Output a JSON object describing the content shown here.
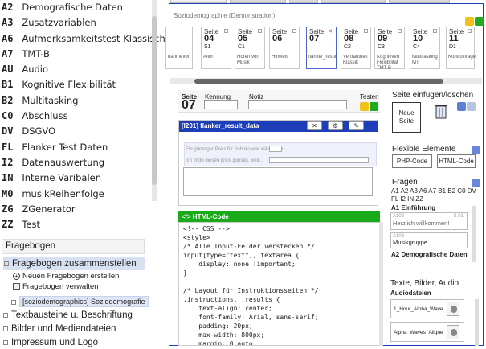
{
  "sidebar": {
    "variables": [
      {
        "code": "A2",
        "label": "Demografische Daten"
      },
      {
        "code": "A3",
        "label": "Zusatzvariablen"
      },
      {
        "code": "A6",
        "label": "Aufmerksamkeitstest Klassisch"
      },
      {
        "code": "A7",
        "label": "TMT-B"
      },
      {
        "code": "AU",
        "label": "Audio"
      },
      {
        "code": "B1",
        "label": "Kognitive Flexibilität"
      },
      {
        "code": "B2",
        "label": "Multitasking"
      },
      {
        "code": "C0",
        "label": "Abschluss"
      },
      {
        "code": "DV",
        "label": "DSGVO"
      },
      {
        "code": "FL",
        "label": "Flanker Test Daten"
      },
      {
        "code": "I2",
        "label": "Datenauswertung"
      },
      {
        "code": "IN",
        "label": "Interne Varibalen"
      },
      {
        "code": "M0",
        "label": "musikReihenfolge"
      },
      {
        "code": "ZG",
        "label": "ZGenerator"
      },
      {
        "code": "ZZ",
        "label": "Test"
      }
    ],
    "section_title": "Fragebogen",
    "tree": {
      "compose": "Fragebogen zusammenstellen",
      "new": "Neuen Fragebogen erstellen",
      "manage": "Fragebogen verwalten",
      "current": "[soziodemographics] Soziodemografie",
      "text_blocks": "Textbausteine u. Beschriftung",
      "media": "Bilder und Mediendateien",
      "impressum": "Impressum und Logo"
    }
  },
  "questionnaire": {
    "title": "Soziodemographie (Demonstration)",
    "cards": [
      {
        "s": "",
        "n": "",
        "c": "",
        "t": "nahmevor"
      },
      {
        "s": "Seite",
        "n": "04",
        "c": "S1",
        "t": "Alter"
      },
      {
        "s": "Seite",
        "n": "05",
        "c": "C1",
        "t": "Hören von Musik"
      },
      {
        "s": "Seite",
        "n": "06",
        "c": "",
        "t": "Hinweis"
      },
      {
        "s": "Seite",
        "n": "07",
        "c": "",
        "t": "flanker_result"
      },
      {
        "s": "Seite",
        "n": "08",
        "c": "C2",
        "t": "Vertrautheit Klassik"
      },
      {
        "s": "Seite",
        "n": "09",
        "c": "C3",
        "t": "Kognitiven Flexibilität TMT-B"
      },
      {
        "s": "Seite",
        "n": "10",
        "c": "C4",
        "t": "Multitasking MT"
      },
      {
        "s": "Seite",
        "n": "11",
        "c": "D1",
        "t": "Kontrollfrage"
      }
    ]
  },
  "editor": {
    "seite_label": "Seite",
    "seite_num": "07",
    "kennung_label": "Kennung",
    "notiz_label": "Notiz",
    "testen_label": "Testen",
    "component_title": "[I201] flanker_result_data",
    "inner_line1": "Ein günstiger Preis für Schokolade wäre       Euro",
    "inner_line2": "Ich finde diesen preis günstig, weil...",
    "code_title": "</> HTML-Code",
    "code": "<!-- CSS -->\n<style>\n/* Alle Input-Felder verstecken */\ninput[type=\"text\"], textarea {\n    display: none !important;\n}\n\n/* Layout für Instruktionsseiten */\n.instructions, .results {\n    text-align: center;\n    font-family: Arial, sans-serif;\n    padding: 20px;\n    max-width: 800px;\n    margin: 0 auto;\n    line-height: 1.3;"
  },
  "right": {
    "insert_title": "Seite einfügen/löschen",
    "new_page": "Neue Seite",
    "flex_title": "Flexible Elemente",
    "php_btn": "PHP-Code",
    "html_btn": "HTML-Code",
    "questions_title": "Fragen",
    "question_codes": "A1 A2 A3 A6 A7 B1 B2 C0 DV FL I2 IN ZZ",
    "a1_section": "A1 Einführung",
    "a102_code": "A102",
    "a102_text": "Herzlich willkommen!",
    "a102_tag": "S.01",
    "a103_code": "A103",
    "a103_text": "Musikgruppe",
    "a2_section": "A2 Demografische Daten",
    "media_title": "Texte, Bilder, Audio",
    "audio_title": "Audiodateien",
    "audio_files": [
      "1_Hour_Alpha_Wave",
      "Alpha_Waves_Aligne"
    ]
  }
}
